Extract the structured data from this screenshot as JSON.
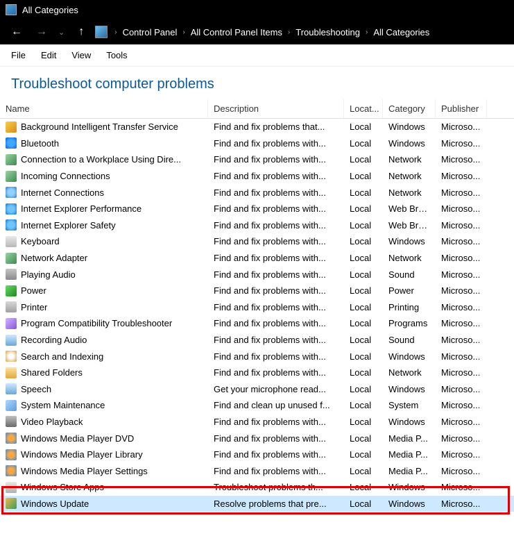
{
  "title": "All Categories",
  "breadcrumb": [
    "Control Panel",
    "All Control Panel Items",
    "Troubleshooting",
    "All Categories"
  ],
  "menu": {
    "file": "File",
    "edit": "Edit",
    "view": "View",
    "tools": "Tools"
  },
  "heading": "Troubleshoot computer problems",
  "columns": {
    "name": "Name",
    "desc": "Description",
    "loc": "Locat...",
    "cat": "Category",
    "pub": "Publisher"
  },
  "rows": [
    {
      "icon": "ic-transfer",
      "name": "Background Intelligent Transfer Service",
      "desc": "Find and fix problems that...",
      "loc": "Local",
      "cat": "Windows",
      "pub": "Microso..."
    },
    {
      "icon": "ic-bt",
      "name": "Bluetooth",
      "desc": "Find and fix problems with...",
      "loc": "Local",
      "cat": "Windows",
      "pub": "Microso..."
    },
    {
      "icon": "ic-net",
      "name": "Connection to a Workplace Using Dire...",
      "desc": "Find and fix problems with...",
      "loc": "Local",
      "cat": "Network",
      "pub": "Microso..."
    },
    {
      "icon": "ic-net",
      "name": "Incoming Connections",
      "desc": "Find and fix problems with...",
      "loc": "Local",
      "cat": "Network",
      "pub": "Microso..."
    },
    {
      "icon": "ic-globe",
      "name": "Internet Connections",
      "desc": "Find and fix problems with...",
      "loc": "Local",
      "cat": "Network",
      "pub": "Microso..."
    },
    {
      "icon": "ic-ie",
      "name": "Internet Explorer Performance",
      "desc": "Find and fix problems with...",
      "loc": "Local",
      "cat": "Web Bro...",
      "pub": "Microso..."
    },
    {
      "icon": "ic-ie",
      "name": "Internet Explorer Safety",
      "desc": "Find and fix problems with...",
      "loc": "Local",
      "cat": "Web Bro...",
      "pub": "Microso..."
    },
    {
      "icon": "ic-kb",
      "name": "Keyboard",
      "desc": "Find and fix problems with...",
      "loc": "Local",
      "cat": "Windows",
      "pub": "Microso..."
    },
    {
      "icon": "ic-net",
      "name": "Network Adapter",
      "desc": "Find and fix problems with...",
      "loc": "Local",
      "cat": "Network",
      "pub": "Microso..."
    },
    {
      "icon": "ic-audio",
      "name": "Playing Audio",
      "desc": "Find and fix problems with...",
      "loc": "Local",
      "cat": "Sound",
      "pub": "Microso..."
    },
    {
      "icon": "ic-power",
      "name": "Power",
      "desc": "Find and fix problems with...",
      "loc": "Local",
      "cat": "Power",
      "pub": "Microso..."
    },
    {
      "icon": "ic-printer",
      "name": "Printer",
      "desc": "Find and fix problems with...",
      "loc": "Local",
      "cat": "Printing",
      "pub": "Microso..."
    },
    {
      "icon": "ic-prog",
      "name": "Program Compatibility Troubleshooter",
      "desc": "Find and fix problems with...",
      "loc": "Local",
      "cat": "Programs",
      "pub": "Microso..."
    },
    {
      "icon": "ic-mic",
      "name": "Recording Audio",
      "desc": "Find and fix problems with...",
      "loc": "Local",
      "cat": "Sound",
      "pub": "Microso..."
    },
    {
      "icon": "ic-search",
      "name": "Search and Indexing",
      "desc": "Find and fix problems with...",
      "loc": "Local",
      "cat": "Windows",
      "pub": "Microso..."
    },
    {
      "icon": "ic-folder",
      "name": "Shared Folders",
      "desc": "Find and fix problems with...",
      "loc": "Local",
      "cat": "Network",
      "pub": "Microso..."
    },
    {
      "icon": "ic-mic",
      "name": "Speech",
      "desc": "Get your microphone read...",
      "loc": "Local",
      "cat": "Windows",
      "pub": "Microso..."
    },
    {
      "icon": "ic-maint",
      "name": "System Maintenance",
      "desc": "Find and clean up unused f...",
      "loc": "Local",
      "cat": "System",
      "pub": "Microso..."
    },
    {
      "icon": "ic-video",
      "name": "Video Playback",
      "desc": "Find and fix problems with...",
      "loc": "Local",
      "cat": "Windows",
      "pub": "Microso..."
    },
    {
      "icon": "ic-wmp",
      "name": "Windows Media Player DVD",
      "desc": "Find and fix problems with...",
      "loc": "Local",
      "cat": "Media P...",
      "pub": "Microso..."
    },
    {
      "icon": "ic-wmp",
      "name": "Windows Media Player Library",
      "desc": "Find and fix problems with...",
      "loc": "Local",
      "cat": "Media P...",
      "pub": "Microso..."
    },
    {
      "icon": "ic-wmp",
      "name": "Windows Media Player Settings",
      "desc": "Find and fix problems with...",
      "loc": "Local",
      "cat": "Media P...",
      "pub": "Microso..."
    },
    {
      "icon": "ic-store",
      "name": "Windows Store Apps",
      "desc": "Troubleshoot problems th...",
      "loc": "Local",
      "cat": "Windows",
      "pub": "Microso..."
    },
    {
      "icon": "ic-update",
      "name": "Windows Update",
      "desc": "Resolve problems that pre...",
      "loc": "Local",
      "cat": "Windows",
      "pub": "Microso...",
      "selected": true
    }
  ]
}
